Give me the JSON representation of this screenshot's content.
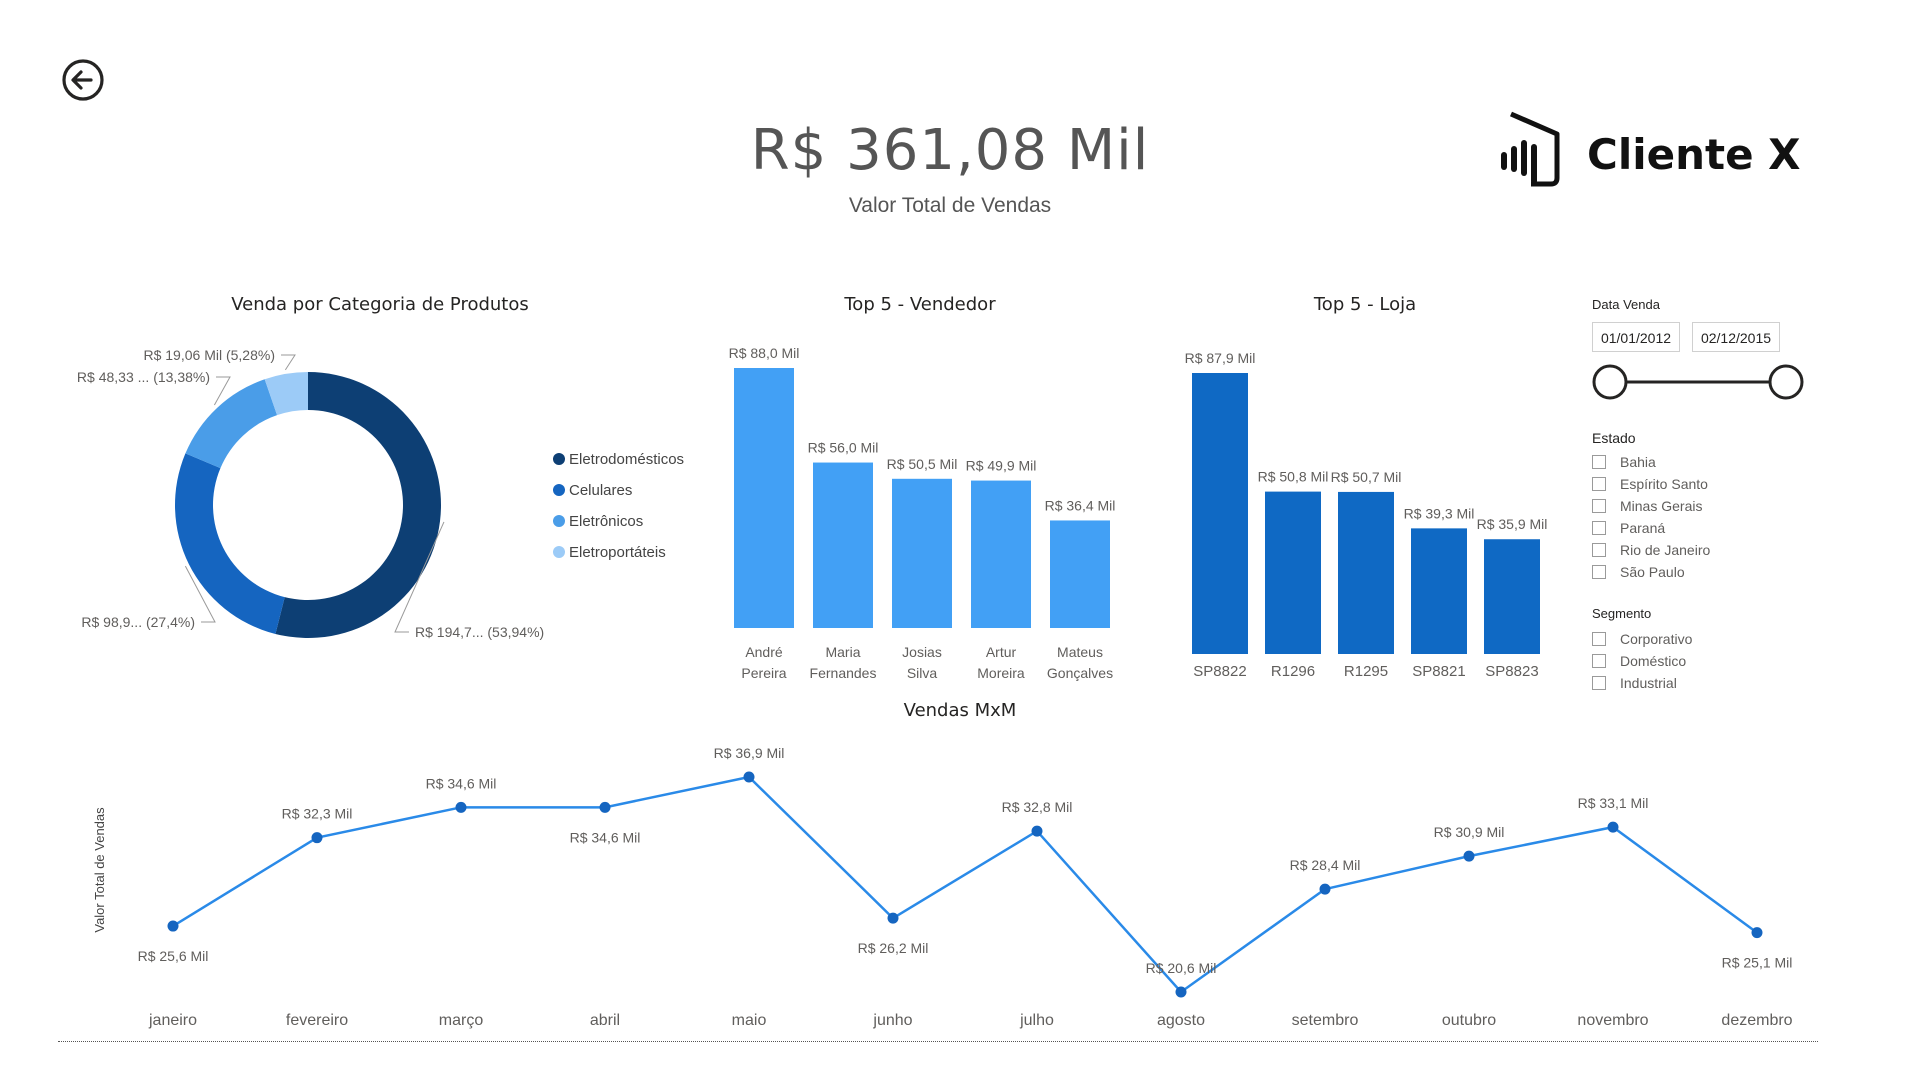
{
  "header": {
    "kpi_value": "R$ 361,08 Mil",
    "kpi_label": "Valor Total de Vendas",
    "logo_text": "Cliente X",
    "icons": {
      "back": "back-arrow-circle-icon",
      "logo": "powerbi-logo-icon"
    }
  },
  "colors": {
    "eletrodomesticos": "#0D3F74",
    "celulares": "#1565C0",
    "eletronicos": "#4A9DE8",
    "eletroportateis": "#9CCBF7",
    "vendedor_bar": "#42A0F5",
    "loja_bar": "#0F69C4",
    "line": "#2A8AE8"
  },
  "donut": {
    "title": "Venda por Categoria de Produtos",
    "legend": [
      "Eletrodomésticos",
      "Celulares",
      "Eletrônicos",
      "Eletroportáteis"
    ],
    "labels": [
      "R$ 194,7... (53,94%)",
      "R$ 98,9... (27,4%)",
      "R$ 48,33 ... (13,38%)",
      "R$ 19,06 Mil (5,28%)"
    ]
  },
  "slicers": {
    "date_title": "Data Venda",
    "date_start": "01/01/2012",
    "date_end": "02/12/2015",
    "estado_title": "Estado",
    "estados": [
      "Bahia",
      "Espírito Santo",
      "Minas Gerais",
      "Paraná",
      "Rio de Janeiro",
      "São Paulo"
    ],
    "segmento_title": "Segmento",
    "segmentos": [
      "Corporativo",
      "Doméstico",
      "Industrial"
    ]
  },
  "chart_data": [
    {
      "type": "pie",
      "title": "Venda por Categoria de Produtos",
      "categories": [
        "Eletrodomésticos",
        "Celulares",
        "Eletrônicos",
        "Eletroportáteis"
      ],
      "values": [
        53.94,
        27.4,
        13.38,
        5.28
      ],
      "data_labels": [
        "R$ 194,7... (53,94%)",
        "R$ 98,9... (27,4%)",
        "R$ 48,33 ... (13,38%)",
        "R$ 19,06 Mil (5,28%)"
      ],
      "legend": "right"
    },
    {
      "type": "bar",
      "title": "Top 5 - Vendedor",
      "categories": [
        [
          "André",
          "Pereira"
        ],
        [
          "Maria",
          "Fernandes"
        ],
        [
          "Josias",
          "Silva"
        ],
        [
          "Artur",
          "Moreira"
        ],
        [
          "Mateus",
          "Gonçalves"
        ]
      ],
      "values": [
        88.0,
        56.0,
        50.5,
        49.9,
        36.4
      ],
      "data_labels": [
        "R$ 88,0 Mil",
        "R$ 56,0 Mil",
        "R$ 50,5 Mil",
        "R$ 49,9 Mil",
        "R$ 36,4 Mil"
      ],
      "ylim": [
        0,
        88
      ]
    },
    {
      "type": "bar",
      "title": "Top 5 - Loja",
      "categories": [
        "SP8822",
        "R1296",
        "R1295",
        "SP8821",
        "SP8823"
      ],
      "values": [
        87.9,
        50.8,
        50.7,
        39.3,
        35.9
      ],
      "data_labels": [
        "R$ 87,9 Mil",
        "R$ 50,8 Mil",
        "R$ 50,7 Mil",
        "R$ 39,3 Mil",
        "R$ 35,9 Mil"
      ],
      "ylim": [
        0,
        87.9
      ]
    },
    {
      "type": "line",
      "title": "Vendas MxM",
      "ylabel": "Valor Total de Vendas",
      "categories": [
        "janeiro",
        "fevereiro",
        "março",
        "abril",
        "maio",
        "junho",
        "julho",
        "agosto",
        "setembro",
        "outubro",
        "novembro",
        "dezembro"
      ],
      "values": [
        25.6,
        32.3,
        34.6,
        34.6,
        36.9,
        26.2,
        32.8,
        20.6,
        28.4,
        30.9,
        33.1,
        25.1
      ],
      "data_labels": [
        "R$ 25,6 Mil",
        "R$ 32,3 Mil",
        "R$ 34,6 Mil",
        "R$ 34,6 Mil",
        "R$ 36,9 Mil",
        "R$ 26,2 Mil",
        "R$ 32,8 Mil",
        "R$ 20,6 Mil",
        "R$ 28,4 Mil",
        "R$ 30,9 Mil",
        "R$ 33,1 Mil",
        "R$ 25,1 Mil"
      ],
      "ylim": [
        20.6,
        36.9
      ],
      "grid": false
    }
  ]
}
